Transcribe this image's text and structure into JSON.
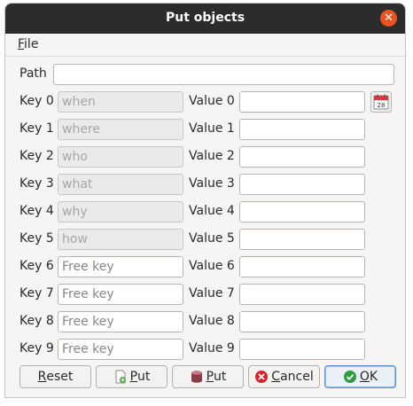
{
  "window": {
    "title": "Put objects"
  },
  "menu": {
    "file": {
      "mnemonic": "F",
      "rest": "ile"
    }
  },
  "path": {
    "label": "Path",
    "value": ""
  },
  "keys": [
    {
      "label": "Key 0",
      "placeholder": "when",
      "readonly": true
    },
    {
      "label": "Key 1",
      "placeholder": "where",
      "readonly": true
    },
    {
      "label": "Key 2",
      "placeholder": "who",
      "readonly": true
    },
    {
      "label": "Key 3",
      "placeholder": "what",
      "readonly": true
    },
    {
      "label": "Key 4",
      "placeholder": "why",
      "readonly": true
    },
    {
      "label": "Key 5",
      "placeholder": "how",
      "readonly": true
    },
    {
      "label": "Key 6",
      "placeholder": "Free key",
      "readonly": false
    },
    {
      "label": "Key 7",
      "placeholder": "Free key",
      "readonly": false
    },
    {
      "label": "Key 8",
      "placeholder": "Free key",
      "readonly": false
    },
    {
      "label": "Key 9",
      "placeholder": "Free key",
      "readonly": false
    }
  ],
  "values": [
    {
      "label": "Value 0",
      "value": ""
    },
    {
      "label": "Value 1",
      "value": ""
    },
    {
      "label": "Value 2",
      "value": ""
    },
    {
      "label": "Value 3",
      "value": ""
    },
    {
      "label": "Value 4",
      "value": ""
    },
    {
      "label": "Value 5",
      "value": ""
    },
    {
      "label": "Value 6",
      "value": ""
    },
    {
      "label": "Value 7",
      "value": ""
    },
    {
      "label": "Value 8",
      "value": ""
    },
    {
      "label": "Value 9",
      "value": ""
    }
  ],
  "calendar": {
    "icon": "calendar-icon",
    "day": "28"
  },
  "buttons": {
    "reset": {
      "mn": "R",
      "rest": "eset"
    },
    "put_new": {
      "mn": "P",
      "rest": "ut",
      "icon": "new-object-icon"
    },
    "put_db": {
      "mn": "P",
      "rest": "ut",
      "icon": "database-icon"
    },
    "cancel": {
      "mn": "C",
      "rest": "ancel",
      "icon": "cancel-icon"
    },
    "ok": {
      "mn": "O",
      "rest": "K",
      "icon": "ok-check-icon"
    }
  },
  "colors": {
    "titlebar": "#2c2c2c",
    "close": "#e95420",
    "ok_accent": "#5b8fc7",
    "cancel_red": "#d0252b",
    "ok_green": "#2e9d3e"
  }
}
